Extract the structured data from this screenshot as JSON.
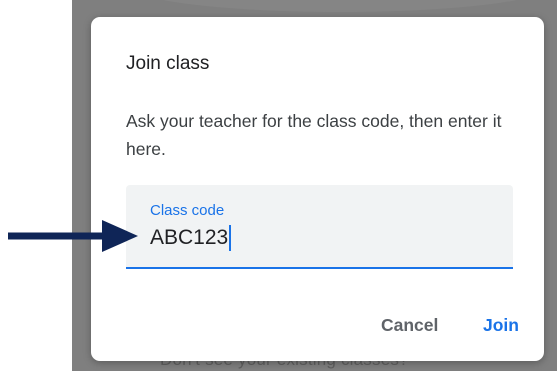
{
  "background": {
    "partial_text": "Don't see your existing classes?"
  },
  "dialog": {
    "title": "Join class",
    "description": "Ask your teacher for the class code, then enter it here.",
    "field": {
      "label": "Class code",
      "value": "ABC123"
    },
    "actions": {
      "cancel_label": "Cancel",
      "join_label": "Join"
    }
  },
  "annotation": {
    "arrow_color": "#0f2557",
    "arrow_icon": "arrow-right-icon"
  },
  "colors": {
    "accent": "#1a73e8",
    "overlay": "#7f7f7f"
  }
}
